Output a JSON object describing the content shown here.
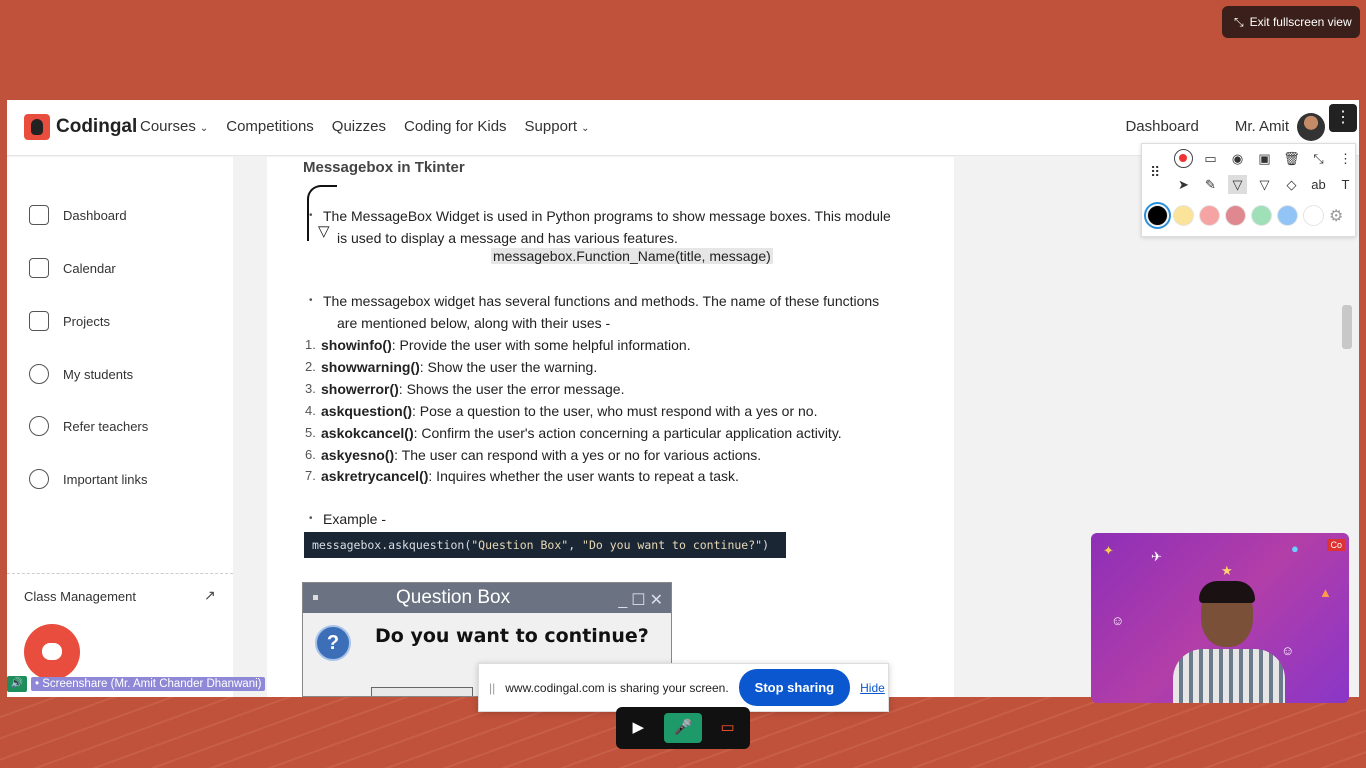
{
  "fullscreen": {
    "exit_label": "Exit fullscreen view"
  },
  "header": {
    "brand": "Codingal",
    "nav": [
      "Courses",
      "Competitions",
      "Quizzes",
      "Coding for Kids",
      "Support"
    ],
    "dashboard_link": "Dashboard",
    "user_name": "Mr. Amit"
  },
  "sidebar": {
    "items": [
      {
        "label": "Dashboard",
        "icon": "clipboard-icon"
      },
      {
        "label": "Calendar",
        "icon": "calendar-icon"
      },
      {
        "label": "Projects",
        "icon": "cube-icon"
      },
      {
        "label": "My students",
        "icon": "users-icon"
      },
      {
        "label": "Refer teachers",
        "icon": "user-plus-icon"
      },
      {
        "label": "Important links",
        "icon": "link-icon"
      }
    ],
    "class_management": "Class Management"
  },
  "doc": {
    "title": "Messagebox in Tkinter",
    "intro_line1": "The MessageBox Widget is used in Python programs to show message boxes. This module",
    "intro_line2": "is used to display a message and has various features.",
    "syntax": "messagebox.Function_Name(title, message)",
    "functions_line1": "The messagebox widget has several functions and methods. The name of these functions",
    "functions_line2": "are mentioned below, along with their uses -",
    "functions": [
      {
        "name": "showinfo()",
        "desc": ": Provide the user with some helpful information."
      },
      {
        "name": "showwarning()",
        "desc": ": Show the user the warning."
      },
      {
        "name": "showerror()",
        "desc": ": Shows the user the error message."
      },
      {
        "name": "askquestion()",
        "desc": ": Pose a question to the user, who must respond with a yes or no."
      },
      {
        "name": "askokcancel()",
        "desc": ": Confirm the user's action concerning a particular application activity."
      },
      {
        "name": "askyesno()",
        "desc": ": The user can respond with a yes or no for various actions."
      },
      {
        "name": "askretrycancel()",
        "desc": ": Inquires whether the user wants to repeat a task."
      }
    ],
    "example_label": "Example -",
    "code_prefix": "messagebox.askquestion(",
    "code_arg1": "\"Question Box\"",
    "code_sep": ", ",
    "code_arg2": "\"Do you want to continue?\"",
    "code_suffix": ")",
    "dialog_title": "Question Box",
    "dialog_question": "Do you want to continue?"
  },
  "annotation_toolbar": {
    "colors": [
      "#000000",
      "#fbe39a",
      "#f5a3a3",
      "#e08890",
      "#9fe0b8",
      "#92c4f6",
      "#ffffff"
    ]
  },
  "screenshare_label": "Screenshare (Mr. Amit Chander Dhanwani)",
  "share_banner": {
    "message": "www.codingal.com is sharing your screen.",
    "stop_label": "Stop sharing",
    "hide_label": "Hide"
  },
  "video": {
    "badge": "Co"
  }
}
